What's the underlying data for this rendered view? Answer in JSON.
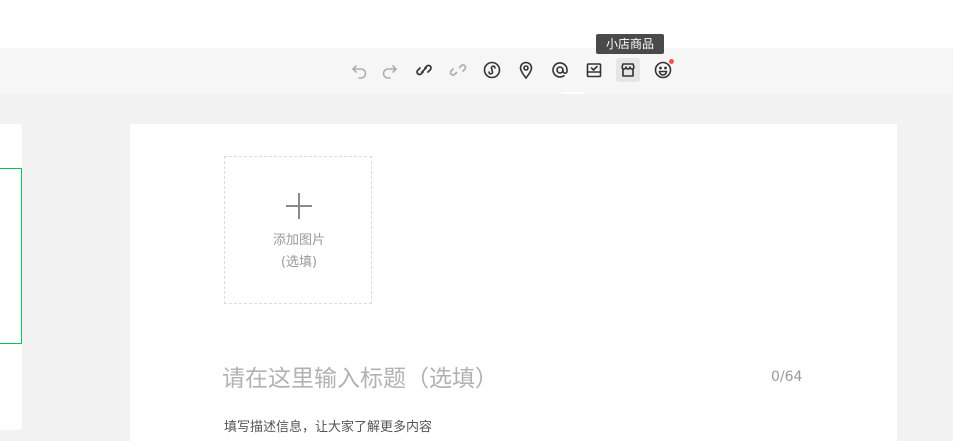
{
  "toolbar": {
    "tools": [
      {
        "name": "undo-icon",
        "label": "撤销",
        "enabled": false
      },
      {
        "name": "redo-icon",
        "label": "重做",
        "enabled": false
      },
      {
        "name": "link-icon",
        "label": "链接",
        "enabled": true
      },
      {
        "name": "unlink-icon",
        "label": "取消链接",
        "enabled": false
      },
      {
        "name": "mini-program-icon",
        "label": "小程序",
        "enabled": true
      },
      {
        "name": "location-icon",
        "label": "位置",
        "enabled": true
      },
      {
        "name": "mention-icon",
        "label": "@",
        "enabled": true
      },
      {
        "name": "vote-icon",
        "label": "投票",
        "enabled": true
      },
      {
        "name": "shop-goods-icon",
        "label": "小店商品",
        "enabled": true,
        "active": true
      },
      {
        "name": "emoji-icon",
        "label": "表情",
        "enabled": true,
        "badge": true
      }
    ],
    "tooltip": "小店商品"
  },
  "upload": {
    "line1": "添加图片",
    "line2": "(选填)"
  },
  "title": {
    "placeholder": "请在这里输入标题（选填）",
    "value": "",
    "counter": "0/64"
  },
  "description": {
    "placeholder": "填写描述信息，让大家了解更多内容",
    "value": ""
  },
  "colors": {
    "accent": "#07c160",
    "badge": "#fa5151",
    "tooltip_bg": "#4a4a4a"
  }
}
